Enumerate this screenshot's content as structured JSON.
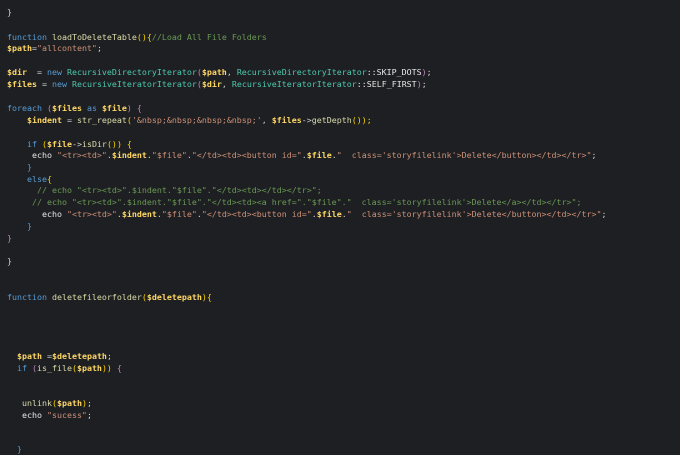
{
  "editor": {
    "lines": [
      {
        "tokens": [
          {
            "t": "}",
            "c": "p"
          }
        ]
      },
      {
        "tokens": [
          {
            "t": "function ",
            "c": "kw"
          },
          {
            "t": "loadToDeleteTable",
            "c": "fn"
          },
          {
            "t": "(){",
            "c": "pb"
          },
          {
            "t": "//Load All File Folders",
            "c": "cm"
          }
        ]
      },
      {
        "tokens": [
          {
            "t": "$path",
            "c": "var"
          },
          {
            "t": "=",
            "c": "p"
          },
          {
            "t": "\"allcontent\"",
            "c": "str"
          },
          {
            "t": ";",
            "c": "p"
          }
        ]
      },
      {
        "tokens": [
          {
            "t": "$dir",
            "c": "var"
          },
          {
            "t": "  = ",
            "c": "p"
          },
          {
            "t": "new ",
            "c": "kw"
          },
          {
            "t": "RecursiveDirectoryIterator",
            "c": "cls"
          },
          {
            "t": "(",
            "c": "pp"
          },
          {
            "t": "$path",
            "c": "var"
          },
          {
            "t": ", ",
            "c": "p"
          },
          {
            "t": "RecursiveDirectoryIterator",
            "c": "cls"
          },
          {
            "t": "::SKIP_DOTS",
            "c": "plain"
          },
          {
            "t": ")",
            "c": "pp"
          },
          {
            "t": ";",
            "c": "p"
          }
        ]
      },
      {
        "tokens": [
          {
            "t": "$files",
            "c": "var"
          },
          {
            "t": " = ",
            "c": "p"
          },
          {
            "t": "new ",
            "c": "kw"
          },
          {
            "t": "RecursiveIteratorIterator",
            "c": "cls"
          },
          {
            "t": "(",
            "c": "pp"
          },
          {
            "t": "$dir",
            "c": "var"
          },
          {
            "t": ", ",
            "c": "p"
          },
          {
            "t": "RecursiveIteratorIterator",
            "c": "cls"
          },
          {
            "t": "::SELF_FIRST",
            "c": "plain"
          },
          {
            "t": ")",
            "c": "pp"
          },
          {
            "t": ";",
            "c": "p"
          }
        ]
      },
      {
        "tokens": [
          {
            "t": "foreach ",
            "c": "kw"
          },
          {
            "t": "(",
            "c": "pp"
          },
          {
            "t": "$files",
            "c": "var"
          },
          {
            "t": " as ",
            "c": "kw"
          },
          {
            "t": "$file",
            "c": "var"
          },
          {
            "t": ")",
            "c": "pp"
          },
          {
            "t": " {",
            "c": "pp"
          }
        ]
      },
      {
        "tokens": [
          {
            "t": "    ",
            "c": "p"
          },
          {
            "t": "$indent",
            "c": "var"
          },
          {
            "t": " = ",
            "c": "p"
          },
          {
            "t": "str_repeat",
            "c": "fn"
          },
          {
            "t": "(",
            "c": "pb"
          },
          {
            "t": "'&nbsp;&nbsp;&nbsp;&nbsp;'",
            "c": "str"
          },
          {
            "t": ", ",
            "c": "p"
          },
          {
            "t": "$files",
            "c": "var"
          },
          {
            "t": "->",
            "c": "p"
          },
          {
            "t": "getDepth",
            "c": "fn"
          },
          {
            "t": "()",
            "c": "pb"
          },
          {
            "t": ");",
            "c": "pb"
          }
        ]
      },
      {
        "tokens": [
          {
            "t": "    if ",
            "c": "kw"
          },
          {
            "t": "(",
            "c": "pb"
          },
          {
            "t": "$file",
            "c": "var"
          },
          {
            "t": "->",
            "c": "p"
          },
          {
            "t": "isDir",
            "c": "fn"
          },
          {
            "t": "()",
            "c": "pb"
          },
          {
            "t": ")",
            "c": "pb"
          },
          {
            "t": " {",
            "c": "pb"
          }
        ]
      },
      {
        "tokens": [
          {
            "t": "     echo ",
            "c": "plain"
          },
          {
            "t": "\"<tr><td>\"",
            "c": "str"
          },
          {
            "t": ".",
            "c": "p"
          },
          {
            "t": "$indent",
            "c": "var"
          },
          {
            "t": ".",
            "c": "p"
          },
          {
            "t": "\"$file\"",
            "c": "str"
          },
          {
            "t": ".",
            "c": "p"
          },
          {
            "t": "\"</td><td><button id=\"",
            "c": "str"
          },
          {
            "t": ".",
            "c": "p"
          },
          {
            "t": "$file",
            "c": "var"
          },
          {
            "t": ".",
            "c": "p"
          },
          {
            "t": "\"  class='storyfilelink'>Delete</button></td></tr>\"",
            "c": "str"
          },
          {
            "t": ";",
            "c": "p"
          }
        ]
      },
      {
        "tokens": [
          {
            "t": "    }",
            "c": "kw"
          }
        ]
      },
      {
        "tokens": [
          {
            "t": "    else",
            "c": "kw"
          },
          {
            "t": "{",
            "c": "pb"
          }
        ]
      },
      {
        "tokens": [
          {
            "t": "      // echo \"<tr><td>\".$indent.\"$file\".\"</td><td></td></tr>\";",
            "c": "cm"
          }
        ]
      },
      {
        "tokens": [
          {
            "t": "     // echo \"<tr><td>\".$indent.\"$file\".\"</td><td><a href=\".\"$file\".\"  class='storyfilelink'>Delete</a></td></tr>\";",
            "c": "cm"
          }
        ]
      },
      {
        "tokens": [
          {
            "t": "       echo ",
            "c": "plain"
          },
          {
            "t": "\"<tr><td>\"",
            "c": "str"
          },
          {
            "t": ".",
            "c": "p"
          },
          {
            "t": "$indent",
            "c": "var"
          },
          {
            "t": ".",
            "c": "p"
          },
          {
            "t": "\"$file\"",
            "c": "str"
          },
          {
            "t": ".",
            "c": "p"
          },
          {
            "t": "\"</td><td><button id=\"",
            "c": "str"
          },
          {
            "t": ".",
            "c": "p"
          },
          {
            "t": "$file",
            "c": "var"
          },
          {
            "t": ".",
            "c": "p"
          },
          {
            "t": "\"  class='storyfilelink'>Delete</button></td></tr>\"",
            "c": "str"
          },
          {
            "t": ";",
            "c": "p"
          }
        ]
      },
      {
        "tokens": [
          {
            "t": "    }",
            "c": "kw"
          }
        ]
      },
      {
        "tokens": [
          {
            "t": "}",
            "c": "pp"
          }
        ]
      },
      {
        "tokens": [
          {
            "t": "}",
            "c": "p"
          }
        ]
      },
      {
        "tokens": [
          {
            "t": "function ",
            "c": "kw"
          },
          {
            "t": "deletefileorfolder",
            "c": "fn"
          },
          {
            "t": "(",
            "c": "pb"
          },
          {
            "t": "$deletepath",
            "c": "var"
          },
          {
            "t": "){",
            "c": "pb"
          }
        ]
      },
      {
        "tokens": [
          {
            "t": "  ",
            "c": "p"
          },
          {
            "t": "$path",
            "c": "var"
          },
          {
            "t": " =",
            "c": "p"
          },
          {
            "t": "$deletepath",
            "c": "var"
          },
          {
            "t": ";",
            "c": "p"
          }
        ]
      },
      {
        "tokens": [
          {
            "t": "  if ",
            "c": "kw"
          },
          {
            "t": "(",
            "c": "pp"
          },
          {
            "t": "is_file",
            "c": "fn"
          },
          {
            "t": "(",
            "c": "pb"
          },
          {
            "t": "$path",
            "c": "var"
          },
          {
            "t": "))",
            "c": "pb"
          },
          {
            "t": " {",
            "c": "pp"
          }
        ]
      },
      {
        "tokens": [
          {
            "t": "   ",
            "c": "p"
          },
          {
            "t": "unlink",
            "c": "fn"
          },
          {
            "t": "(",
            "c": "pb"
          },
          {
            "t": "$path",
            "c": "var"
          },
          {
            "t": ")",
            "c": "pb"
          },
          {
            "t": ";",
            "c": "p"
          }
        ]
      },
      {
        "tokens": [
          {
            "t": "   echo ",
            "c": "plain"
          },
          {
            "t": "\"sucess\"",
            "c": "str"
          },
          {
            "t": ";",
            "c": "p"
          }
        ]
      },
      {
        "tokens": [
          {
            "t": "  }",
            "c": "kw"
          }
        ]
      }
    ]
  }
}
